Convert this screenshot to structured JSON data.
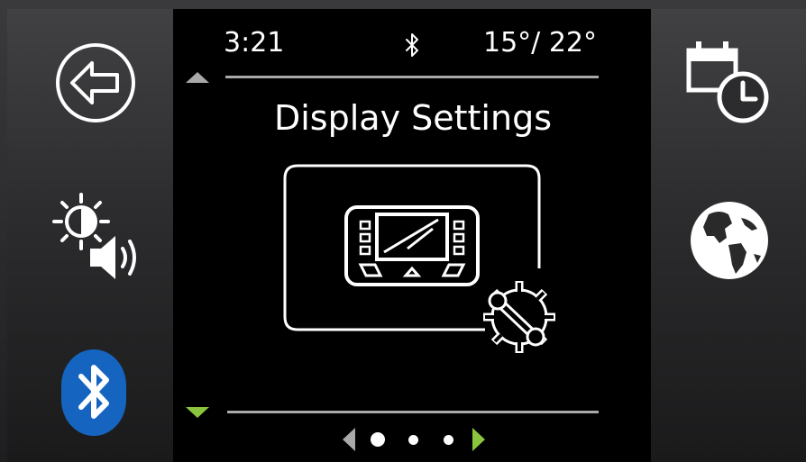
{
  "status_bar": {
    "time": "3:21",
    "bluetooth_icon": "bluetooth-icon",
    "temperature": "15°/ 22°"
  },
  "screen": {
    "title": "Display Settings",
    "icon": "display-settings-icon"
  },
  "left_panel": {
    "items": [
      {
        "icon": "back-arrow-icon"
      },
      {
        "icon": "brightness-volume-icon"
      },
      {
        "icon": "bluetooth-icon"
      }
    ]
  },
  "right_panel": {
    "items": [
      {
        "icon": "calendar-clock-icon"
      },
      {
        "icon": "globe-icon"
      }
    ]
  },
  "pager": {
    "page_count": 3,
    "current_page": 1
  },
  "colors": {
    "accent_green": "#8bc53f",
    "bluetooth_blue": "#1565c0",
    "screen_bg": "#000000",
    "rule_gray": "#a9a9a9"
  }
}
